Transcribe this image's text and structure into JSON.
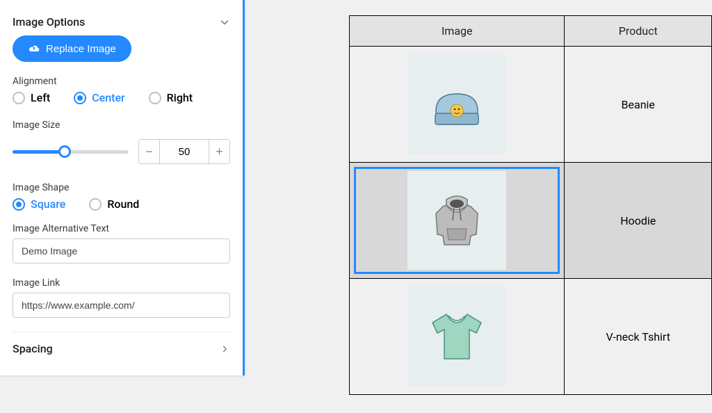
{
  "panel": {
    "title": "Image Options",
    "replace_label": "Replace Image",
    "alignment": {
      "label": "Alignment",
      "options": {
        "left": "Left",
        "center": "Center",
        "right": "Right"
      },
      "selected": "center"
    },
    "size": {
      "label": "Image Size",
      "value": "50",
      "percent": 45
    },
    "shape": {
      "label": "Image Shape",
      "options": {
        "square": "Square",
        "round": "Round"
      },
      "selected": "square"
    },
    "alt": {
      "label": "Image Alternative Text",
      "value": "Demo Image"
    },
    "link": {
      "label": "Image Link",
      "value": "https://www.example.com/"
    },
    "spacing_label": "Spacing"
  },
  "table": {
    "headers": {
      "image": "Image",
      "product": "Product"
    },
    "rows": [
      {
        "name": "Beanie",
        "selected": false,
        "icon": "beanie"
      },
      {
        "name": "Hoodie",
        "selected": true,
        "icon": "hoodie"
      },
      {
        "name": "V-neck Tshirt",
        "selected": false,
        "icon": "tshirt"
      }
    ]
  }
}
